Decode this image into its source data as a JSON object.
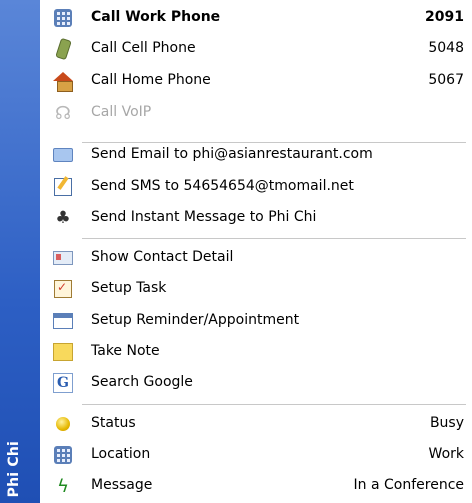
{
  "sidebar": {
    "title": "Phi Chi"
  },
  "menu": {
    "calls": [
      {
        "label": "Call Work Phone",
        "value": "2091",
        "bold": true,
        "icon": "work-phone-icon",
        "enabled": true
      },
      {
        "label": "Call Cell Phone",
        "value": "5048",
        "bold": false,
        "icon": "cell-phone-icon",
        "enabled": true
      },
      {
        "label": "Call Home Phone",
        "value": "5067",
        "bold": false,
        "icon": "home-phone-icon",
        "enabled": true
      },
      {
        "label": "Call VoIP",
        "value": "",
        "bold": false,
        "icon": "voip-icon",
        "enabled": false
      }
    ],
    "messages": [
      {
        "label": "Send Email to phi@asianrestaurant.com",
        "icon": "email-icon"
      },
      {
        "label": "Send SMS to 54654654@tmomail.net",
        "icon": "sms-icon"
      },
      {
        "label": "Send Instant Message to Phi Chi",
        "icon": "instant-message-icon"
      }
    ],
    "actions": [
      {
        "label": "Show Contact Detail",
        "icon": "contact-card-icon"
      },
      {
        "label": "Setup Task",
        "icon": "task-icon"
      },
      {
        "label": "Setup Reminder/Appointment",
        "icon": "calendar-icon"
      },
      {
        "label": "Take Note",
        "icon": "note-icon"
      },
      {
        "label": "Search Google",
        "icon": "google-icon"
      }
    ],
    "info": [
      {
        "label": "Status",
        "value": "Busy",
        "icon": "status-icon"
      },
      {
        "label": "Location",
        "value": "Work",
        "icon": "location-icon"
      },
      {
        "label": "Message",
        "value": "In a Conference",
        "icon": "message-icon"
      }
    ]
  }
}
